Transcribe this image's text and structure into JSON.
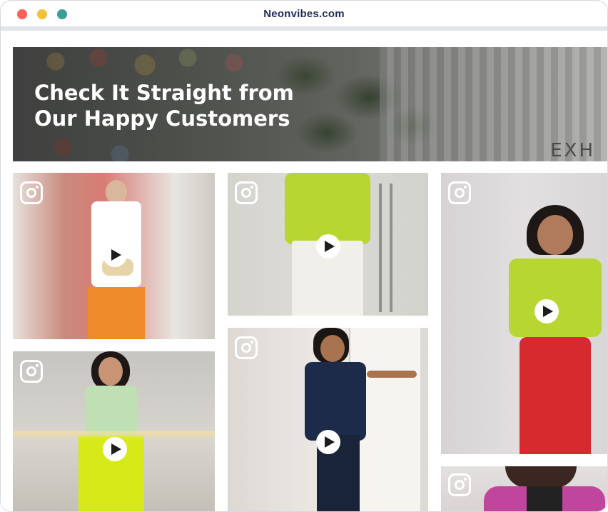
{
  "window": {
    "url": "Neonvibes.com",
    "controls": [
      {
        "name": "close",
        "color": "#ff5f57"
      },
      {
        "name": "minimize",
        "color": "#f2c23a"
      },
      {
        "name": "maximize",
        "color": "#3a9e95"
      }
    ]
  },
  "hero": {
    "title_line1": "Check It Straight from",
    "title_line2": "Our Happy Customers",
    "background_text": "EXH"
  },
  "gallery": {
    "tiles": [
      {
        "id": "tile-1",
        "icon": "instagram-icon",
        "has_play": true
      },
      {
        "id": "tile-2",
        "icon": "instagram-icon",
        "has_play": true
      },
      {
        "id": "tile-3",
        "icon": "instagram-icon",
        "has_play": true
      },
      {
        "id": "tile-4",
        "icon": "instagram-icon",
        "has_play": true
      },
      {
        "id": "tile-5",
        "icon": "instagram-icon",
        "has_play": true
      },
      {
        "id": "tile-6",
        "icon": "instagram-icon",
        "has_play": false
      }
    ]
  },
  "colors": {
    "url_text": "#1e2b5a",
    "play_button": "#ffffff",
    "lime_outfit": "#b7d631",
    "red_skirt": "#d62a2f",
    "orange_pants": "#f08b2c",
    "navy_dress": "#1c2b4a"
  }
}
